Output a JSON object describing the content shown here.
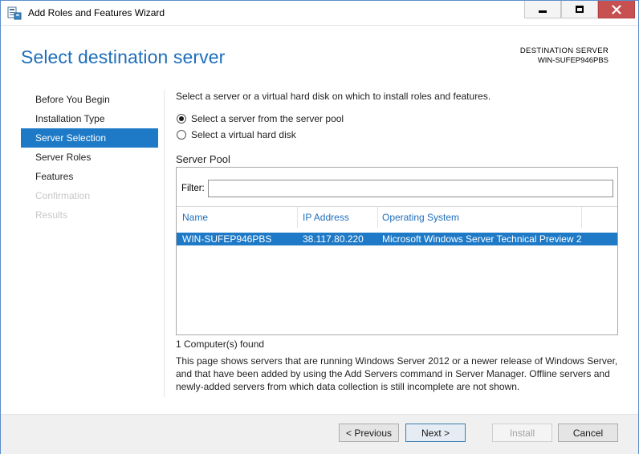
{
  "window": {
    "title": "Add Roles and Features Wizard",
    "icon": "server-wizard-icon",
    "controls": {
      "minimize": "minimize-icon",
      "maximize": "maximize-icon",
      "close": "close-icon"
    }
  },
  "header": {
    "title": "Select destination server",
    "destination_label": "DESTINATION SERVER",
    "destination_value": "WIN-SUFEP946PBS"
  },
  "nav": {
    "items": [
      {
        "label": "Before You Begin",
        "state": "normal"
      },
      {
        "label": "Installation Type",
        "state": "normal"
      },
      {
        "label": "Server Selection",
        "state": "active"
      },
      {
        "label": "Server Roles",
        "state": "normal"
      },
      {
        "label": "Features",
        "state": "normal"
      },
      {
        "label": "Confirmation",
        "state": "disabled"
      },
      {
        "label": "Results",
        "state": "disabled"
      }
    ]
  },
  "content": {
    "intro": "Select a server or a virtual hard disk on which to install roles and features.",
    "radio_pool": "Select a server from the server pool",
    "radio_vhd": "Select a virtual hard disk",
    "selected_option": "pool",
    "pool_title": "Server Pool",
    "filter_label": "Filter:",
    "filter_value": "",
    "columns": [
      "Name",
      "IP Address",
      "Operating System"
    ],
    "rows": [
      {
        "name": "WIN-SUFEP946PBS",
        "ip": "38.117.80.220",
        "os": "Microsoft Windows Server Technical Preview 2"
      }
    ],
    "found_text": "1 Computer(s) found",
    "description": "This page shows servers that are running Windows Server 2012 or a newer release of Windows Server, and that have been added by using the Add Servers command in Server Manager. Offline servers and newly-added servers from which data collection is still incomplete are not shown."
  },
  "footer": {
    "previous": "< Previous",
    "next": "Next >",
    "install": "Install",
    "cancel": "Cancel"
  },
  "colors": {
    "accent": "#1e7ac7",
    "title_blue": "#1e6ebd",
    "close_button": "#c75050"
  }
}
